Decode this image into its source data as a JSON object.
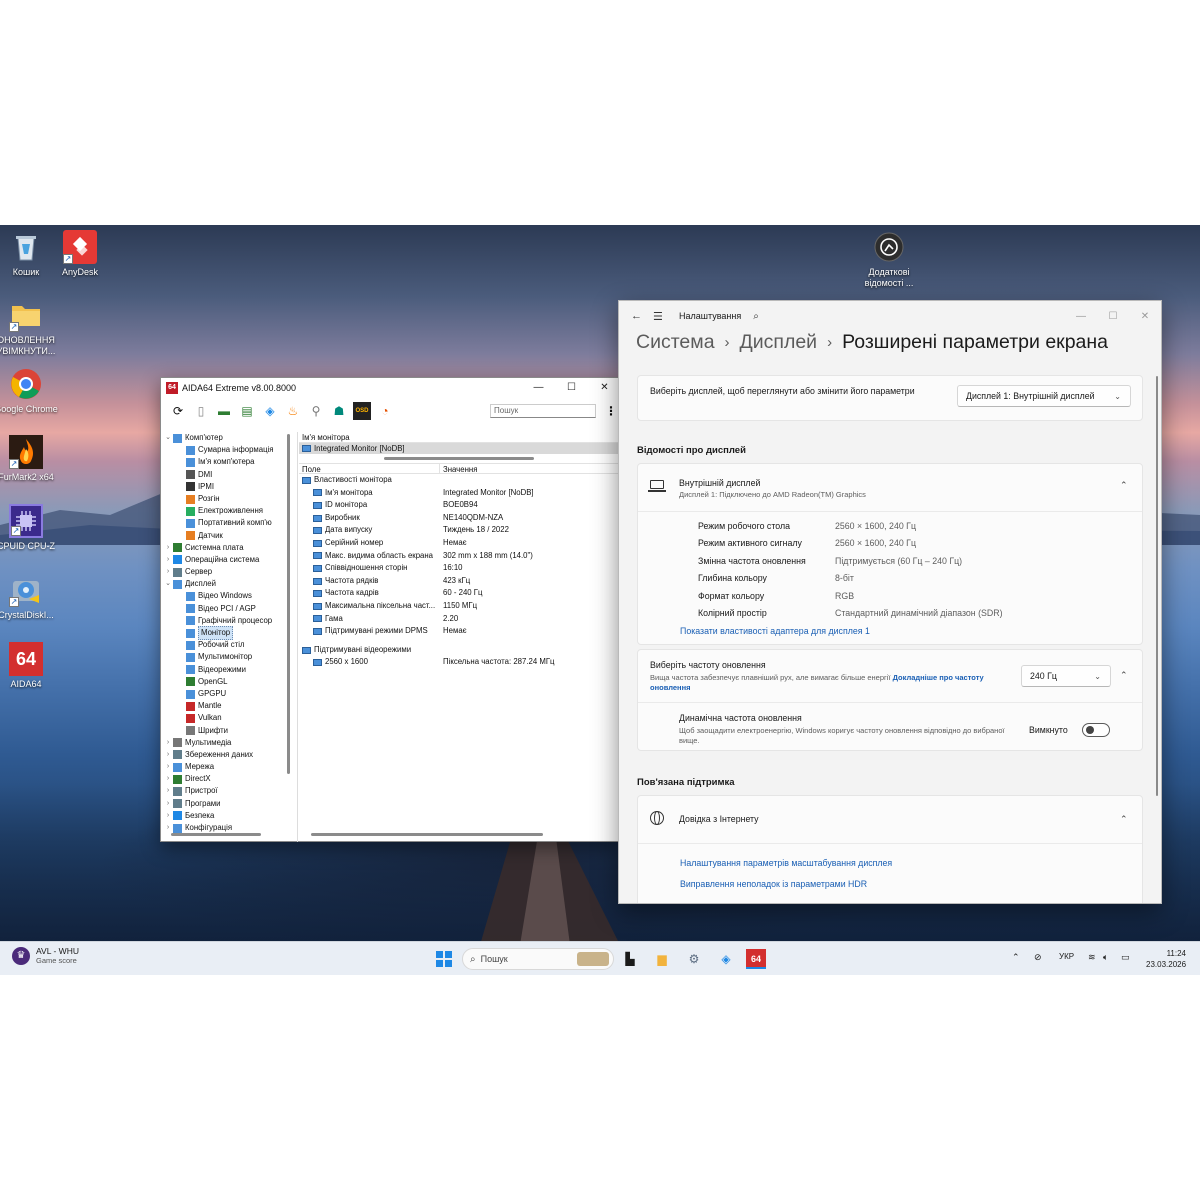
{
  "desktop": {
    "icons": [
      {
        "label": "Кошик",
        "icon": "recycle-bin-icon"
      },
      {
        "label": "AnyDesk",
        "icon": "anydesk-icon"
      },
      {
        "label": "ОНОВЛЕННЯ УВІМКНУТИ...",
        "icon": "folder-icon"
      },
      {
        "label": "Google Chrome",
        "icon": "chrome-icon"
      },
      {
        "label": "FurMark2 x64",
        "icon": "furmark-icon"
      },
      {
        "label": "CPUID CPU-Z",
        "icon": "cpuz-icon"
      },
      {
        "label": "CrystalDiskI...",
        "icon": "crystaldisk-icon"
      },
      {
        "label": "AIDA64",
        "icon": "aida64-icon"
      },
      {
        "label": "Додаткові відомості ...",
        "icon": "info-icon"
      }
    ]
  },
  "aida": {
    "title": "AIDA64 Extreme v8.00.8000",
    "logo": "64",
    "window_buttons": [
      "—",
      "☐",
      "✕"
    ],
    "search_placeholder": "Пошук",
    "more": "⋮",
    "toolbar_icons": [
      "refresh-icon",
      "report-icon",
      "motherboard-icon",
      "memory-icon",
      "network-icon",
      "flame-icon",
      "antenna-icon",
      "user-icon",
      "osd-icon",
      "gauge-icon"
    ],
    "osd_label": "OSD",
    "tree": [
      {
        "label": "Комп'ютер",
        "level": 0,
        "exp": "⌄",
        "color": "#4a90d9"
      },
      {
        "label": "Сумарна інформація",
        "level": 1,
        "exp": "",
        "color": "#4a90d9"
      },
      {
        "label": "Ім'я комп'ютера",
        "level": 1,
        "exp": "",
        "color": "#4a90d9"
      },
      {
        "label": "DMI",
        "level": 1,
        "exp": "",
        "color": "#555"
      },
      {
        "label": "IPMI",
        "level": 1,
        "exp": "",
        "color": "#333"
      },
      {
        "label": "Розгін",
        "level": 1,
        "exp": "",
        "color": "#e67e22"
      },
      {
        "label": "Електроживлення",
        "level": 1,
        "exp": "",
        "color": "#27ae60"
      },
      {
        "label": "Портативний комп'ю",
        "level": 1,
        "exp": "",
        "color": "#4a90d9"
      },
      {
        "label": "Датчик",
        "level": 1,
        "exp": "",
        "color": "#e67e22"
      },
      {
        "label": "Системна плата",
        "level": 0,
        "exp": "›",
        "color": "#2e7d32"
      },
      {
        "label": "Операційна система",
        "level": 0,
        "exp": "›",
        "color": "#1e88e5"
      },
      {
        "label": "Сервер",
        "level": 0,
        "exp": "›",
        "color": "#607d8b"
      },
      {
        "label": "Дисплей",
        "level": 0,
        "exp": "⌄",
        "color": "#4a90d9"
      },
      {
        "label": "Відео Windows",
        "level": 1,
        "exp": "",
        "color": "#4a90d9"
      },
      {
        "label": "Відео PCI / AGP",
        "level": 1,
        "exp": "",
        "color": "#4a90d9"
      },
      {
        "label": "Графічний процесор",
        "level": 1,
        "exp": "",
        "color": "#4a90d9"
      },
      {
        "label": "Монітор",
        "level": 1,
        "exp": "",
        "color": "#4a90d9",
        "selected": true
      },
      {
        "label": "Робочий стіл",
        "level": 1,
        "exp": "",
        "color": "#4a90d9"
      },
      {
        "label": "Мультимонітор",
        "level": 1,
        "exp": "",
        "color": "#4a90d9"
      },
      {
        "label": "Відеорежими",
        "level": 1,
        "exp": "",
        "color": "#4a90d9"
      },
      {
        "label": "OpenGL",
        "level": 1,
        "exp": "",
        "color": "#2e7d32"
      },
      {
        "label": "GPGPU",
        "level": 1,
        "exp": "",
        "color": "#4a90d9"
      },
      {
        "label": "Mantle",
        "level": 1,
        "exp": "",
        "color": "#c62828"
      },
      {
        "label": "Vulkan",
        "level": 1,
        "exp": "",
        "color": "#c62828"
      },
      {
        "label": "Шрифти",
        "level": 1,
        "exp": "",
        "color": "#777"
      },
      {
        "label": "Мультимедіа",
        "level": 0,
        "exp": "›",
        "color": "#777"
      },
      {
        "label": "Збереження даних",
        "level": 0,
        "exp": "›",
        "color": "#607d8b"
      },
      {
        "label": "Мережа",
        "level": 0,
        "exp": "›",
        "color": "#4a90d9"
      },
      {
        "label": "DirectX",
        "level": 0,
        "exp": "›",
        "color": "#2e7d32"
      },
      {
        "label": "Пристрої",
        "level": 0,
        "exp": "›",
        "color": "#607d8b"
      },
      {
        "label": "Програми",
        "level": 0,
        "exp": "›",
        "color": "#607d8b"
      },
      {
        "label": "Безпека",
        "level": 0,
        "exp": "›",
        "color": "#1e88e5"
      },
      {
        "label": "Конфігурація",
        "level": 0,
        "exp": "›",
        "color": "#4a90d9"
      }
    ],
    "device_header": "Ім'я монітора",
    "device_row": "Integrated Monitor [NoDB]",
    "col_field": "Поле",
    "col_value": "Значення",
    "properties": [
      {
        "k": "Властивості монітора",
        "v": "",
        "group": true
      },
      {
        "k": "Ім'я монітора",
        "v": "Integrated Monitor [NoDB]"
      },
      {
        "k": "ID монітора",
        "v": "BOE0B94"
      },
      {
        "k": "Виробник",
        "v": "NE140QDM-NZA"
      },
      {
        "k": "Дата випуску",
        "v": "Тиждень 18 / 2022"
      },
      {
        "k": "Серійний номер",
        "v": "Немає"
      },
      {
        "k": "Макс. видима область екрана",
        "v": "302 mm x 188 mm (14.0\")"
      },
      {
        "k": "Співвідношення сторін",
        "v": "16:10"
      },
      {
        "k": "Частота рядків",
        "v": "423 кГц"
      },
      {
        "k": "Частота кадрів",
        "v": "60 - 240 Гц"
      },
      {
        "k": "Максимальна піксельна част...",
        "v": "1150 МГц"
      },
      {
        "k": "Гама",
        "v": "2.20"
      },
      {
        "k": "Підтримувані режими DPMS",
        "v": "Немає"
      },
      {
        "k": "",
        "v": "",
        "spacer": true
      },
      {
        "k": "Підтримувані відеорежими",
        "v": "",
        "group": true
      },
      {
        "k": "2560 x 1600",
        "v": "Піксельна частота: 287.24 МГц"
      }
    ]
  },
  "settings": {
    "app_title": "Налаштування",
    "back": "←",
    "menu": "☰",
    "search_icon": "⌕",
    "window_buttons": [
      "—",
      "☐",
      "✕"
    ],
    "breadcrumb": {
      "system": "Система",
      "display": "Дисплей",
      "current": "Розширені параметри екрана",
      "sep": "›"
    },
    "select_display_text": "Виберіть дисплей, щоб переглянути або змінити його параметри",
    "display_dropdown": "Дисплей 1: Внутрішній дисплей",
    "info_section": "Відомості про дисплей",
    "internal_title": "Внутрішній дисплей",
    "internal_sub": "Дисплей 1: Підключено до AMD Radeon(TM) Graphics",
    "details": [
      {
        "k": "Режим робочого стола",
        "v": "2560 × 1600, 240 Гц"
      },
      {
        "k": "Режим активного сигналу",
        "v": "2560 × 1600, 240 Гц"
      },
      {
        "k": "Змінна частота оновлення",
        "v": "Підтримується (60 Гц – 240 Гц)"
      },
      {
        "k": "Глибина кольору",
        "v": "8-біт"
      },
      {
        "k": "Формат кольору",
        "v": "RGB"
      },
      {
        "k": "Колірний простір",
        "v": "Стандартний динамічний діапазон (SDR)"
      }
    ],
    "adapter_link": "Показати властивості адаптера для дисплея 1",
    "refresh_title": "Виберіть частоту оновлення",
    "refresh_sub": "Вища частота забезпечує плавніший рух, але вимагає більше енергії",
    "refresh_link": "Докладніше про частоту оновлення",
    "refresh_value": "240 Гц",
    "dynamic_title": "Динамічна частота оновлення",
    "dynamic_sub": "Щоб заощадити електроенергію, Windows коригує частоту оновлення відповідно до вибраної вище.",
    "dynamic_state": "Вимкнуто",
    "support_section": "Пов'язана підтримка",
    "help_title": "Довідка з Інтернету",
    "help_links": [
      "Налаштування параметрів масштабування дисплея",
      "Виправлення неполадок із параметрами HDR"
    ]
  },
  "taskbar": {
    "widget_title": "AVL - WHU",
    "widget_sub": "Game score",
    "search_placeholder": "Пошук",
    "language": "УКР",
    "time": "11:24",
    "date": "23.03.2026"
  }
}
